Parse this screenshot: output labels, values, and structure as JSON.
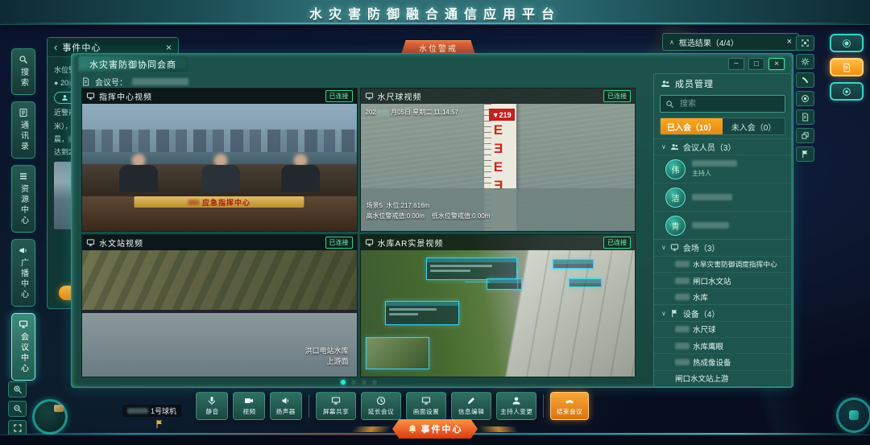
{
  "app": {
    "title": "水灾害防御融合通信应用平台"
  },
  "glyphs": {
    "back": "‹",
    "close": "×",
    "min": "−",
    "max": "□",
    "chev_down": "∨",
    "chev_up": "∧"
  },
  "left_nav": {
    "items": [
      {
        "label": "搜索",
        "icon": "search-icon"
      },
      {
        "label": "通讯录",
        "icon": "contacts-icon"
      },
      {
        "label": "资源中心",
        "icon": "resource-icon"
      },
      {
        "label": "广播中心",
        "icon": "broadcast-icon"
      },
      {
        "label": "会议中心",
        "icon": "meeting-icon",
        "active": true
      }
    ]
  },
  "event_panel": {
    "title": "事件中心",
    "list_title": "水位警",
    "time_fragment": "20",
    "body_fragments": [
      "近警戒",
      "米），",
      "晨，",
      "达到2"
    ]
  },
  "alert_tab": {
    "label": "水位警戒"
  },
  "filter_chip": {
    "label": "框选结果（4/4）"
  },
  "window": {
    "title": "水灾害防御协同会商",
    "meeting_no_label": "会议号："
  },
  "videos": [
    {
      "title": "指挥中心视频",
      "status": "已连接",
      "plaque": "应急指挥中心"
    },
    {
      "title": "水尺球视频",
      "status": "已连接",
      "timestamp_prefix": "202",
      "timestamp": "月05日 星期二 11:14:57",
      "gauge_marker": "▼219",
      "gauge_letters": [
        "E",
        "E",
        "E",
        "E"
      ],
      "info_line1": "场景5  水位:217.616m",
      "info_line2": "高水位警戒值:0.00m    低水位警戒值:0.00m"
    },
    {
      "title": "水文站视频",
      "status": "已连接",
      "overlay_line1": "洪口电站水库",
      "overlay_line2": "上游面"
    },
    {
      "title": "水库AR实景视频",
      "status": "已连接"
    }
  ],
  "pagination": {
    "count": 4,
    "active_index": 0
  },
  "members": {
    "title": "成员管理",
    "search_placeholder": "搜索",
    "tab_joined": "已入会（10）",
    "tab_not_joined": "未入会（0）",
    "section_people": "会议人员（3）",
    "people": [
      {
        "avatar": "伟",
        "role": "主持人"
      },
      {
        "avatar": "洁",
        "role": ""
      },
      {
        "avatar": "青",
        "role": ""
      }
    ],
    "section_rooms": "会场（3）",
    "rooms": [
      "水旱灾害防御调度指挥中心",
      "闸口水文站",
      "水库"
    ],
    "section_devices": "设备（4）",
    "devices": [
      "水尺球",
      "水库鹰眼",
      "热成像设备",
      "闸口水文站上游"
    ]
  },
  "toolbar": {
    "buttons": [
      {
        "label": "静音",
        "icon": "mic-icon"
      },
      {
        "label": "视频",
        "icon": "camera-icon"
      },
      {
        "label": "扬声器",
        "icon": "speaker-icon"
      },
      {
        "label": "屏幕共享",
        "icon": "screenshare-icon"
      },
      {
        "label": "延长会议",
        "icon": "clock-icon"
      },
      {
        "label": "画面设置",
        "icon": "display-settings-icon"
      },
      {
        "label": "信息编辑",
        "icon": "pencil-icon"
      },
      {
        "label": "主持人变更",
        "icon": "host-icon"
      },
      {
        "label": "结束会议",
        "icon": "end-call-icon"
      }
    ]
  },
  "event_center_button": {
    "label": "事件中心"
  },
  "map": {
    "marker_label": "1号球机"
  },
  "colors": {
    "accent_orange": "#f59a23",
    "accent_cyan": "#35e0d2",
    "alert_red": "#d23a2a",
    "connected_green": "#35e08c",
    "panel_teal": "#1d544d"
  }
}
